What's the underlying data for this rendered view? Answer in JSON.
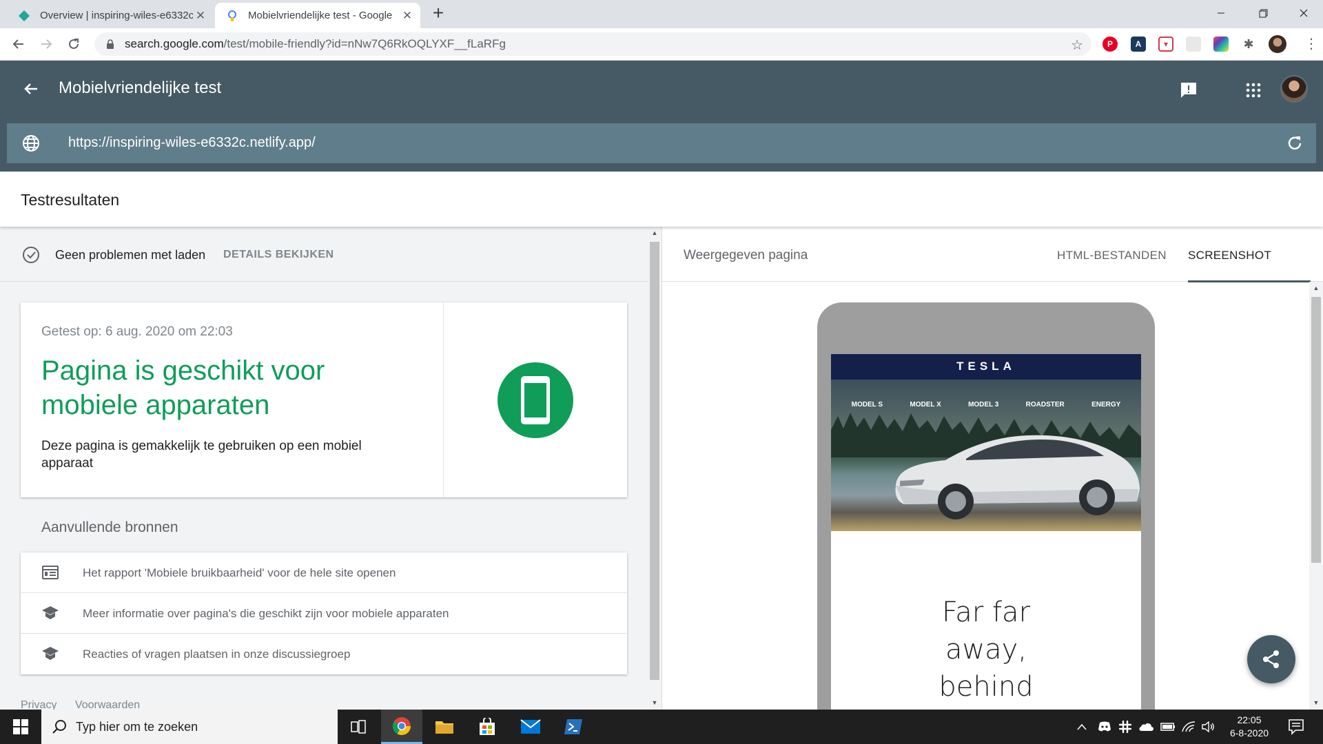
{
  "browser": {
    "tabs": [
      {
        "title": "Overview | inspiring-wiles-e6332c",
        "active": false
      },
      {
        "title": "Mobielvriendelijke test - Google",
        "active": true
      }
    ],
    "new_tab_symbol": "+",
    "address": {
      "host": "search.google.com",
      "path": "/test/mobile-friendly?id=nNw7Q6RkOQLYXF__fLaRFg"
    },
    "extensions": [
      {
        "name": "pinterest-icon",
        "color": "#e60023"
      },
      {
        "name": "extension-icon-a",
        "color": "#1b3a5c"
      },
      {
        "name": "extension-icon-b",
        "color": "#d1384f"
      },
      {
        "name": "extension-icon-c",
        "color": "#e8e8e8"
      },
      {
        "name": "extension-icon-d",
        "color": "#5f3dc4"
      },
      {
        "name": "puzzle-icon",
        "color": "#5f6368"
      }
    ]
  },
  "app": {
    "title": "Mobielvriendelijke test",
    "tested_url": "https://inspiring-wiles-e6332c.netlify.app/",
    "header_color": "#455a64",
    "urlbar_color": "#607d8b"
  },
  "results": {
    "title": "Testresultaten",
    "status_text": "Geen problemen met laden",
    "details_link": "DETAILS BEKIJKEN",
    "tested_on": "Getest op: 6 aug. 2020 om 22:03",
    "headline": "Pagina is geschikt voor mobiele apparaten",
    "subtext": "Deze pagina is gemakkelijk te gebruiken op een mobiel apparaat",
    "success_color": "#0f9d58",
    "more_resources_title": "Aanvullende bronnen",
    "resources": [
      {
        "icon": "report-icon",
        "text": "Het rapport 'Mobiele bruikbaarheid' voor de hele site openen"
      },
      {
        "icon": "school-icon",
        "text": "Meer informatie over pagina's die geschikt zijn voor mobiele apparaten"
      },
      {
        "icon": "school-icon",
        "text": "Reacties of vragen plaatsen in onze discussiegroep"
      }
    ],
    "footer_links": [
      "Privacy",
      "Voorwaarden"
    ]
  },
  "rendered": {
    "title": "Weergegeven pagina",
    "tabs": [
      {
        "label": "HTML-BESTANDEN",
        "selected": false
      },
      {
        "label": "SCREENSHOT",
        "selected": true
      }
    ],
    "site": {
      "logo": "TESLA",
      "nav": [
        "MODEL S",
        "MODEL X",
        "MODEL 3",
        "ROADSTER",
        "ENERGY"
      ],
      "copy_lines": [
        "Far far",
        "away,",
        "behind"
      ]
    }
  },
  "taskbar": {
    "search_placeholder": "Typ hier om te zoeken",
    "time": "22:05",
    "date": "6-8-2020"
  }
}
